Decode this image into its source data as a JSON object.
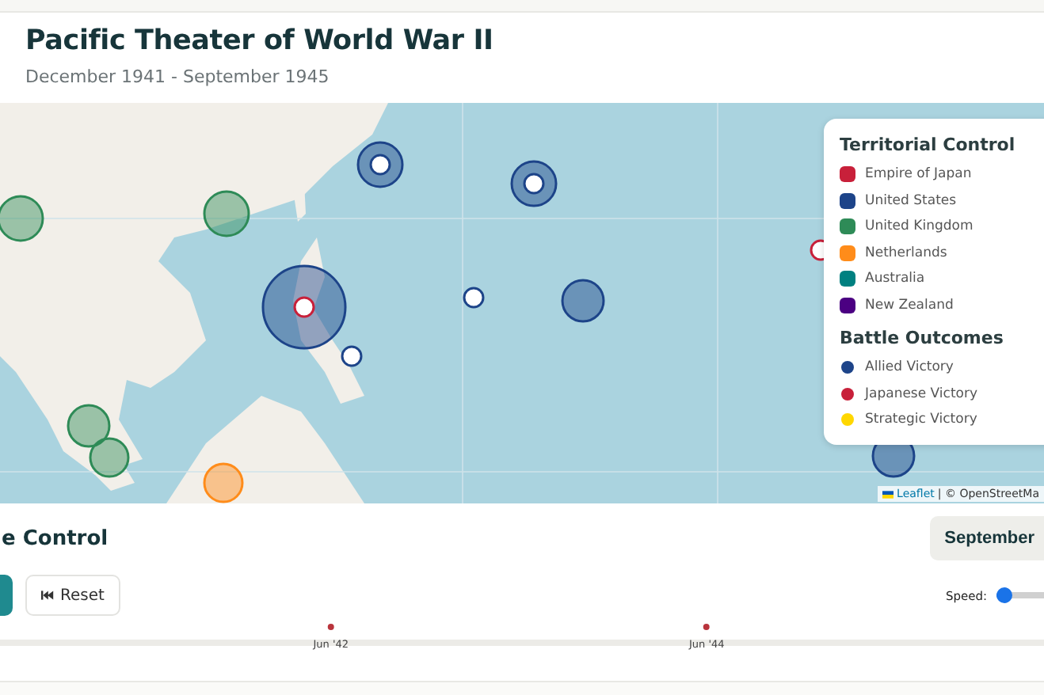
{
  "header": {
    "title": "Pacific Theater of World War II",
    "subtitle": "December 1941 - September 1945"
  },
  "legend": {
    "territorial_title": "Territorial Control",
    "territories": [
      {
        "label": "Empire of Japan",
        "color": "#c8203a"
      },
      {
        "label": "United States",
        "color": "#1d4489"
      },
      {
        "label": "United Kingdom",
        "color": "#2e8b57"
      },
      {
        "label": "Netherlands",
        "color": "#ff8c1a"
      },
      {
        "label": "Australia",
        "color": "#008080"
      },
      {
        "label": "New Zealand",
        "color": "#4b0082"
      }
    ],
    "outcomes_title": "Battle Outcomes",
    "outcomes": [
      {
        "label": "Allied Victory",
        "color": "#1d4489"
      },
      {
        "label": "Japanese Victory",
        "color": "#c8203a"
      },
      {
        "label": "Strategic Victory",
        "color": "#ffd700"
      }
    ]
  },
  "attribution": {
    "link": "Leaflet",
    "text": "| © OpenStreetMa"
  },
  "controls": {
    "title": "e Control",
    "date_button": "September",
    "reset_button": "Reset",
    "speed_label": "Speed:",
    "speed_slider": {
      "level": 0.12
    }
  },
  "timeline": {
    "markers": [
      {
        "label": "Jun '42"
      },
      {
        "label": "Jun '44"
      }
    ]
  }
}
